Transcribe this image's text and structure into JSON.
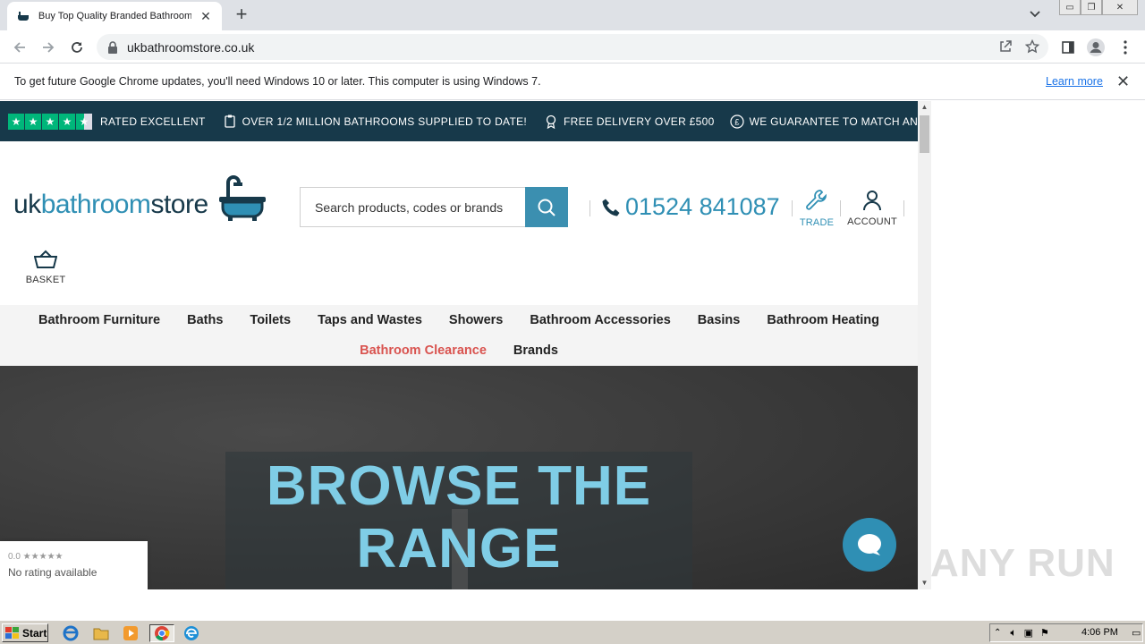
{
  "browser": {
    "tab_title": "Buy Top Quality Branded Bathrooms",
    "url": "ukbathroomstore.co.uk",
    "infobar_text": "To get future Google Chrome updates, you'll need Windows 10 or later. This computer is using Windows 7.",
    "infobar_link": "Learn more"
  },
  "promo": {
    "rating": "RATED EXCELLENT",
    "supplied": "OVER 1/2 MILLION BATHROOMS SUPPLIED TO DATE!",
    "delivery": "FREE DELIVERY OVER £500",
    "guarantee": "WE GUARANTEE TO MATCH ANY GENUINE PRICE"
  },
  "header": {
    "logo_uk": "uk",
    "logo_bath": "bathroom",
    "logo_store": "store",
    "search_placeholder": "Search products, codes or brands",
    "phone": "01524 841087",
    "trade": "TRADE",
    "account": "ACCOUNT",
    "basket": "BASKET"
  },
  "nav": {
    "row1": [
      "Bathroom Furniture",
      "Baths",
      "Toilets",
      "Taps and Wastes",
      "Showers",
      "Bathroom Accessories",
      "Basins",
      "Bathroom Heating"
    ],
    "row2": [
      "Bathroom Clearance",
      "Brands"
    ]
  },
  "hero": {
    "line1": "BROWSE THE",
    "line2": "RANGE"
  },
  "rating_widget": {
    "score": "0.0",
    "text": "No rating available"
  },
  "watermark": "ANY RUN",
  "taskbar": {
    "start": "Start",
    "clock": "4:06 PM"
  },
  "colors": {
    "brand_dark": "#17394a",
    "brand_blue": "#2f8fb4",
    "clearance_red": "#d9534f",
    "trustpilot_green": "#00b67a",
    "hero_text": "#7fcde6"
  }
}
